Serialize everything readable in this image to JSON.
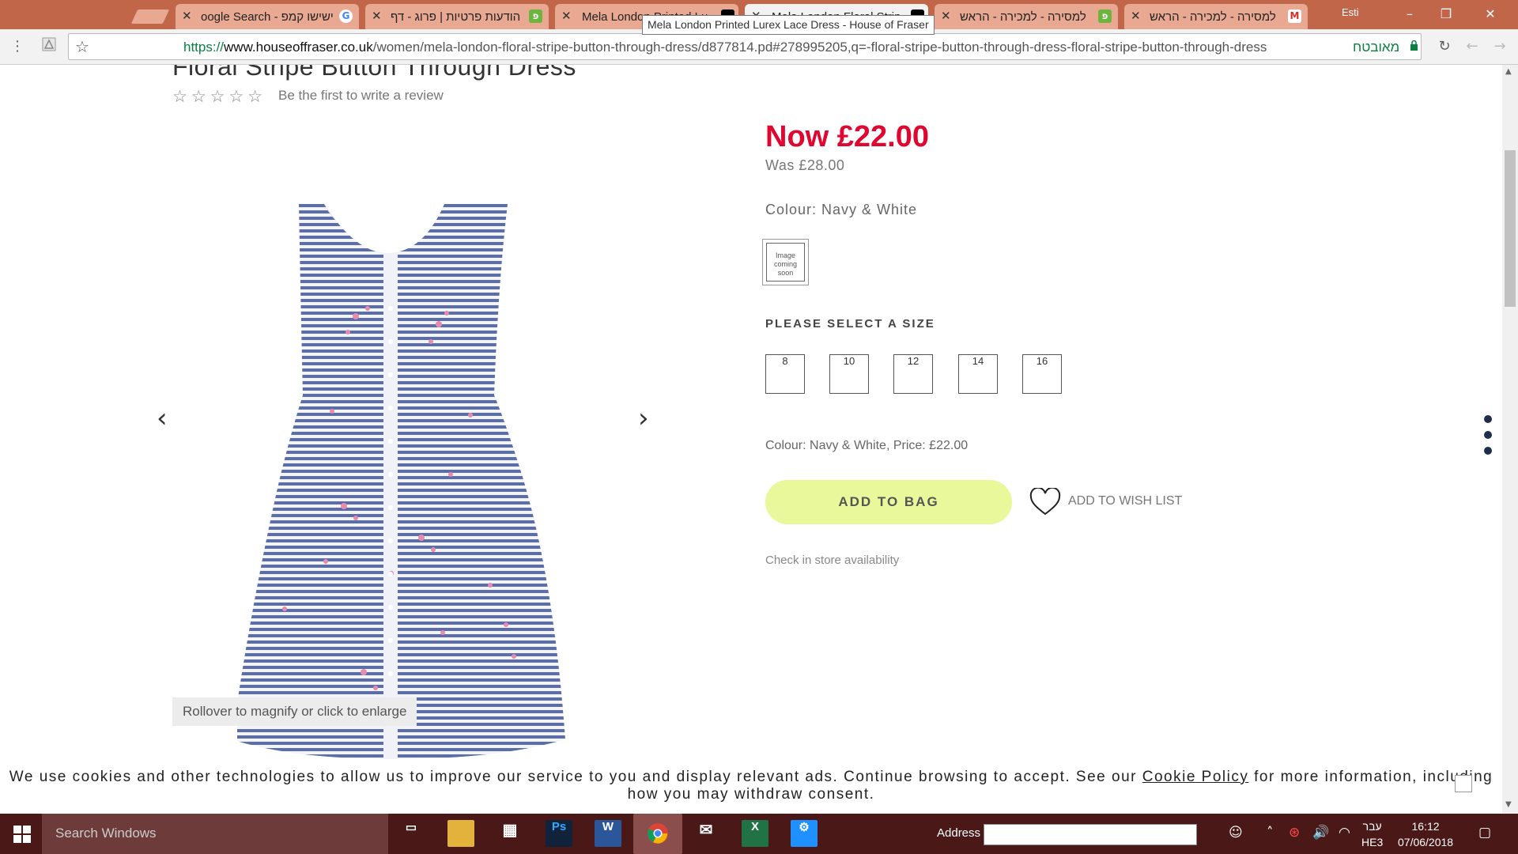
{
  "browser": {
    "tabs": [
      {
        "title": "oogle Search - ישישו קמפ",
        "favicon": "google-icon",
        "icon_text": "G",
        "color": "#4285f4"
      },
      {
        "title": "הודעות פרטיות | פרוג - דף",
        "favicon": "prog-icon",
        "icon_text": "פ",
        "color": "#6cb33f"
      },
      {
        "title": "Mela London Printed Lu",
        "favicon": "hof-icon",
        "icon_text": "",
        "color": "#000000"
      },
      {
        "title": "Mela London Floral Strip",
        "favicon": "hof-icon",
        "icon_text": "",
        "color": "#000000"
      },
      {
        "title": "למסירה - למכירה - הראש",
        "favicon": "prog-icon",
        "icon_text": "פ",
        "color": "#6cb33f"
      },
      {
        "title": "למסירה - למכירה - הראש",
        "favicon": "gmail-icon",
        "icon_text": "M",
        "color": "#d93025"
      }
    ],
    "tooltip": "Mela London Printed Lurex Lace Dress - House of Fraser",
    "profile_name": "Esti",
    "url_scheme": "https://",
    "url_host": "www.houseoffraser.co.uk",
    "url_path": "/women/mela-london-floral-stripe-button-through-dress/d877814.pd#278995205,q=-floral-stripe-button-through-dress-floral-stripe-button-through-dress",
    "secure_label": "מאובטח"
  },
  "product": {
    "title": "Floral Stripe Button Through Dress",
    "stars": "☆☆☆☆☆",
    "review_prompt": "Be the first to write a review",
    "magnify_hint": "Rollover to magnify or click to enlarge",
    "price_now": "Now £22.00",
    "price_was": "Was £28.00",
    "colour_label": "Colour: Navy & White",
    "swatch_text": "Image coming soon",
    "size_heading": "PLEASE SELECT A SIZE",
    "sizes": [
      "8",
      "10",
      "12",
      "14",
      "16"
    ],
    "colour_price": "Colour: Navy & White, Price: £22.00",
    "add_to_bag": "ADD TO BAG",
    "wish_list": "ADD TO WISH LIST",
    "store_availability": "Check in store availability",
    "accent_price_color": "#e0062f",
    "button_color": "#e8f89b"
  },
  "cookie": {
    "text_before": "We use cookies and other technologies to allow us to improve our service to you and display relevant ads. Continue browsing to accept. See our ",
    "link": "Cookie Policy",
    "text_after": " for more information, including how you may withdraw consent."
  },
  "taskbar": {
    "search_placeholder": "Search Windows",
    "address_label": "Address",
    "lang_top": "עבר",
    "lang_bottom": "HE3",
    "time": "16:12",
    "date": "07/06/2018"
  }
}
